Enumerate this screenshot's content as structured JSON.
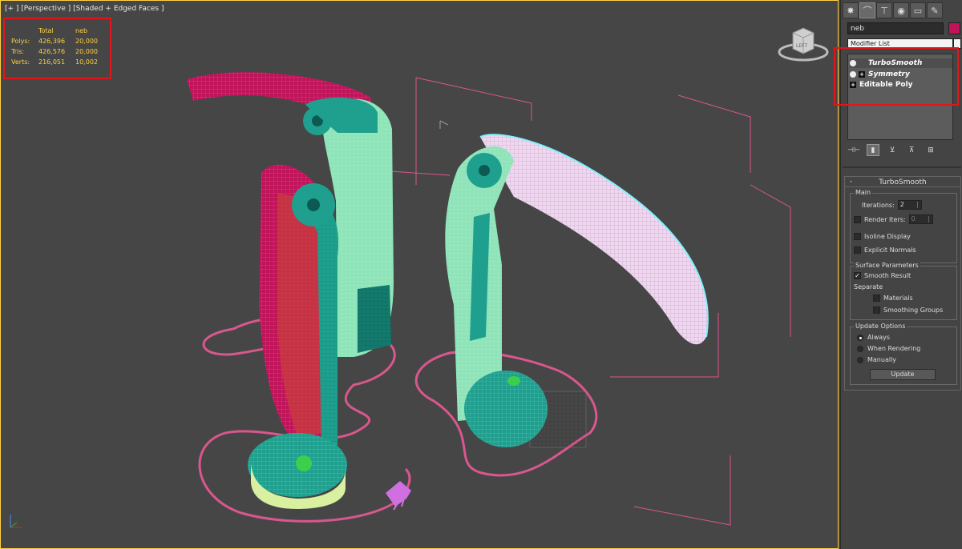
{
  "viewport": {
    "label": "[+ ] [Perspective ] [Shaded + Edged Faces ]",
    "stats": {
      "headers": [
        "",
        "Total",
        "neb"
      ],
      "rows": [
        {
          "label": "Polys:",
          "total": "426,396",
          "sel": "20,000"
        },
        {
          "label": "Tris:",
          "total": "426,576",
          "sel": "20,000"
        },
        {
          "label": "Verts:",
          "total": "216,051",
          "sel": "10,002"
        }
      ]
    },
    "viewcube_label": "LEFT"
  },
  "command_panel": {
    "tabs": [
      {
        "name": "create-tab",
        "glyph": "✸"
      },
      {
        "name": "modify-tab",
        "glyph": "⌒"
      },
      {
        "name": "hierarchy-tab",
        "glyph": "⊤"
      },
      {
        "name": "motion-tab",
        "glyph": "◉"
      },
      {
        "name": "display-tab",
        "glyph": "▭"
      },
      {
        "name": "utilities-tab",
        "glyph": "✎"
      }
    ],
    "object_name": "neb",
    "object_color": "#c0135a",
    "modifier_list_label": "Modifier List",
    "stack": [
      {
        "label": "TurboSmooth",
        "italic": true,
        "bulb": true,
        "plus": false
      },
      {
        "label": "Symmetry",
        "italic": true,
        "bulb": true,
        "plus": true
      },
      {
        "label": "Editable Poly",
        "italic": false,
        "bulb": false,
        "plus": true
      }
    ],
    "stack_tools": [
      "⊣⊢",
      "▮",
      "⊻",
      "⊼",
      "⊞"
    ],
    "rollout": {
      "title": "TurboSmooth",
      "collapse": "-",
      "main_group": "Main",
      "iterations_label": "Iterations:",
      "iterations_value": "2",
      "render_iters_label": "Render Iters:",
      "render_iters_value": "0",
      "render_iters_checked": false,
      "isoline_label": "Isoline Display",
      "isoline_checked": false,
      "explicit_normals_label": "Explicit Normals",
      "explicit_normals_checked": false,
      "surface_group": "Surface Parameters",
      "smooth_result_label": "Smooth Result",
      "smooth_result_checked": true,
      "separate_label": "Separate",
      "materials_label": "Materials",
      "materials_checked": false,
      "smoothing_groups_label": "Smoothing Groups",
      "smoothing_groups_checked": false,
      "update_group": "Update Options",
      "always_label": "Always",
      "when_rendering_label": "When Rendering",
      "manually_label": "Manually",
      "update_selected": "Always",
      "update_button": "Update"
    }
  },
  "colors": {
    "viewport_bg": "#464646",
    "highlight_frame": "#e4141a",
    "active_border": "#ffd040",
    "stats_text": "#ffd040",
    "teal": "#1fa08f",
    "magenta": "#c0135a",
    "pink_spline": "#d9578e"
  }
}
